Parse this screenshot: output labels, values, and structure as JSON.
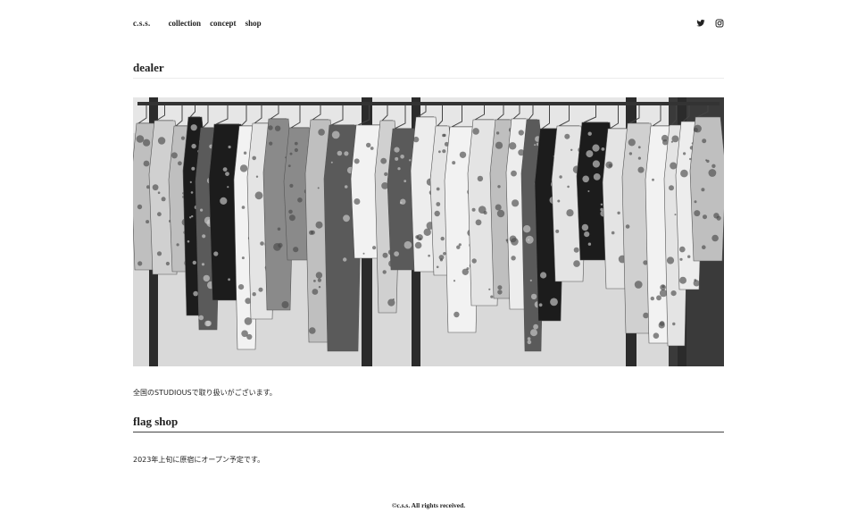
{
  "header": {
    "logo": "c.s.s.",
    "nav": [
      {
        "label": "collection"
      },
      {
        "label": "concept"
      },
      {
        "label": "shop"
      }
    ],
    "social": [
      "twitter-icon",
      "instagram-icon"
    ]
  },
  "sections": {
    "dealer": {
      "title": "dealer",
      "image": "black-and-white photo of printed shirts hanging on a clothing rack",
      "text": "全国のSTUDIOUSで取り扱いがございます。"
    },
    "flag_shop": {
      "title": "flag shop",
      "text": "2023年上旬に原宿にオープン予定です。"
    }
  },
  "footer": {
    "copyright": "©c.s.s. All rights received."
  },
  "colors": {
    "text": "#222222",
    "background": "#ffffff",
    "rule_light": "#ececec",
    "rule_dark": "#444444"
  }
}
